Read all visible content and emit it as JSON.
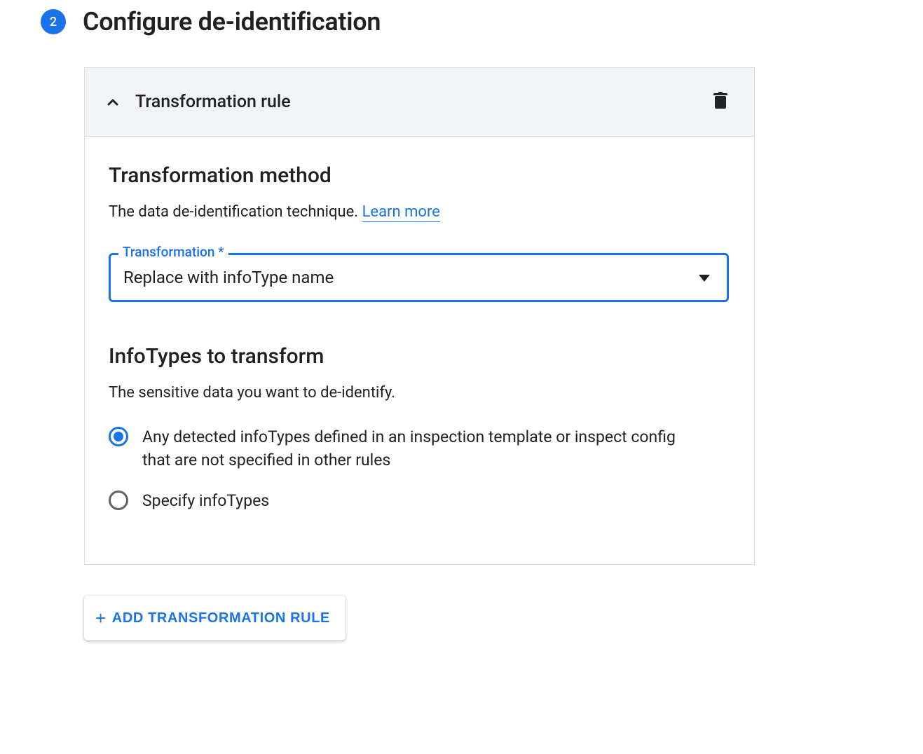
{
  "step": {
    "number": "2",
    "title": "Configure de-identification"
  },
  "card": {
    "header_title": "Transformation rule",
    "method_section": {
      "heading": "Transformation method",
      "description": "The data de-identification technique.",
      "learn_more": "Learn more"
    },
    "transformation_select": {
      "label": "Transformation *",
      "value": "Replace with infoType name"
    },
    "infotypes_section": {
      "heading": "InfoTypes to transform",
      "description": "The sensitive data you want to de-identify."
    },
    "radios": {
      "any_detected": "Any detected infoTypes defined in an inspection template or inspect config that are not specified in other rules",
      "specify": "Specify infoTypes",
      "selected": "any_detected"
    }
  },
  "add_button": {
    "label": "ADD TRANSFORMATION RULE"
  }
}
